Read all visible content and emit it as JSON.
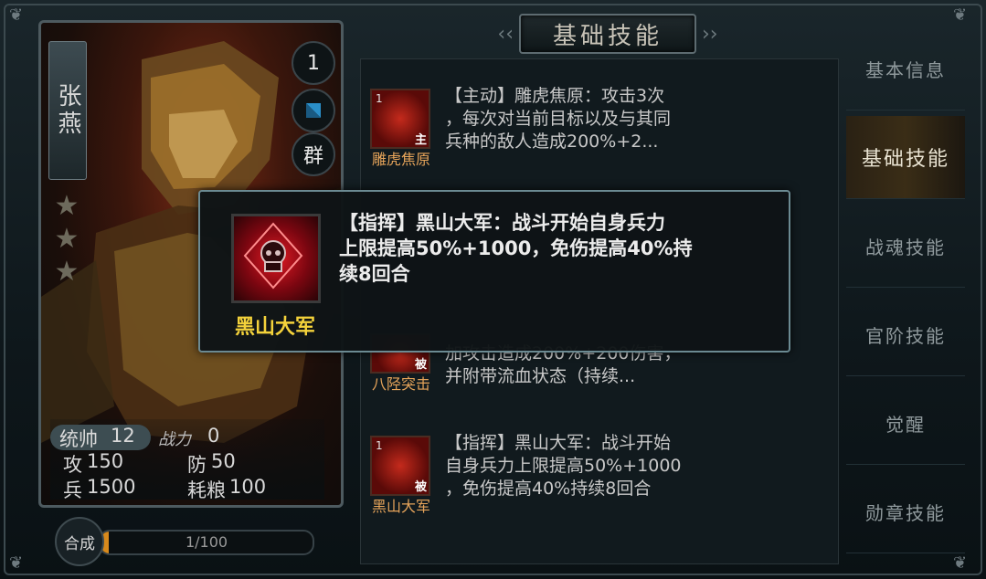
{
  "title": "基础技能",
  "hero": {
    "name": "张燕",
    "level_badge": "1",
    "faction": "群",
    "stars": 3,
    "command_label": "统帅",
    "command_value": "12",
    "power_label": "战力",
    "power_value": "0",
    "attack_label": "攻",
    "attack_value": "150",
    "defense_label": "防",
    "defense_value": "50",
    "troops_label": "兵",
    "troops_value": "1500",
    "food_label": "耗粮",
    "food_value": "100"
  },
  "synthesis": {
    "button_label": "合成",
    "progress_text": "1/100",
    "progress_fraction": 0.01,
    "fill_color": "#d88a1c"
  },
  "skills": [
    {
      "level": "1",
      "type": "主",
      "name": "雕虎焦原",
      "desc_lines": [
        "【主动】雕虎焦原：攻击3次",
        "，每次对当前目标以及与其同",
        "兵种的敌人造成200%+2..."
      ]
    },
    {
      "level": "",
      "type": "被",
      "name": "八陉突击",
      "desc_lines": [
        "加攻击造成200%+200伤害，",
        "并附带流血状态（持续..."
      ]
    },
    {
      "level": "1",
      "type": "被",
      "name": "黑山大军",
      "desc_lines": [
        "【指挥】黑山大军：战斗开始",
        "自身兵力上限提高50%+1000",
        "，免伤提高40%持续8回合"
      ]
    }
  ],
  "tabs": [
    {
      "label": "基本信息",
      "active": false
    },
    {
      "label": "基础技能",
      "active": true
    },
    {
      "label": "战魂技能",
      "active": false
    },
    {
      "label": "官阶技能",
      "active": false
    },
    {
      "label": "觉醒",
      "active": false
    },
    {
      "label": "勋章技能",
      "active": false
    }
  ],
  "tooltip": {
    "name": "黑山大军",
    "desc_lines": [
      "【指挥】黑山大军：战斗开始自身兵力",
      "上限提高50%+1000，免伤提高40%持",
      "续8回合"
    ],
    "name_color": "#f4d23b"
  }
}
